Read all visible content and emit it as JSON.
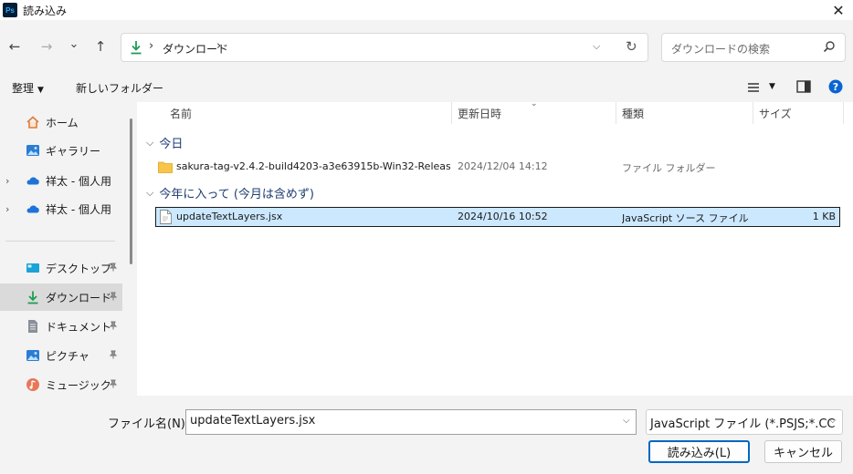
{
  "window": {
    "app_icon_text": "Ps",
    "title": "読み込み",
    "close_glyph": "✕"
  },
  "nav": {
    "back_glyph": "←",
    "forward_glyph": "→",
    "recent_glyph": "⌄",
    "up_glyph": "↑",
    "breadcrumb_sep": "›",
    "breadcrumb": [
      "ダウンロード"
    ],
    "dropdown_glyph": "⌵",
    "refresh_glyph": "↻",
    "search_placeholder": "ダウンロードの検索"
  },
  "command_bar": {
    "organize": "整理",
    "new_folder": "新しいフォルダー",
    "dropdown_glyph": "▼"
  },
  "sidebar": {
    "items": [
      {
        "label": "ホーム",
        "icon": "home-icon",
        "expandable": false,
        "pinned": false
      },
      {
        "label": "ギャラリー",
        "icon": "gallery-icon",
        "expandable": false,
        "pinned": false
      },
      {
        "label": "祥太 - 個人用",
        "icon": "cloud-icon",
        "expandable": true,
        "pinned": false
      },
      {
        "label": "祥太 - 個人用",
        "icon": "cloud-icon",
        "expandable": true,
        "pinned": false
      },
      {
        "label": "デスクトップ",
        "icon": "desktop-icon",
        "expandable": false,
        "pinned": true
      },
      {
        "label": "ダウンロード",
        "icon": "download-icon",
        "expandable": false,
        "pinned": true,
        "selected": true
      },
      {
        "label": "ドキュメント",
        "icon": "document-icon",
        "expandable": false,
        "pinned": true
      },
      {
        "label": "ピクチャ",
        "icon": "pictures-icon",
        "expandable": false,
        "pinned": true
      },
      {
        "label": "ミュージック",
        "icon": "music-icon",
        "expandable": false,
        "pinned": true
      }
    ],
    "expand_glyph": "›",
    "pin_glyph": "📌"
  },
  "file_list": {
    "columns": {
      "name": "名前",
      "date": "更新日時",
      "type": "種類",
      "size": "サイズ"
    },
    "sort_glyph": "⌄",
    "group_chevron": "⌵",
    "groups": [
      {
        "label": "今日",
        "rows": [
          {
            "name": "sakura-tag-v2.4.2-build4203-a3e63915b-Win32-Releas...",
            "date": "2024/12/04 14:12",
            "type": "ファイル フォルダー",
            "size": "",
            "kind": "folder"
          }
        ]
      },
      {
        "label": "今年に入って (今月は含めず)",
        "rows": [
          {
            "name": "updateTextLayers.jsx",
            "date": "2024/10/16 10:52",
            "type": "JavaScript ソース ファイル",
            "size": "1 KB",
            "kind": "file",
            "selected": true
          }
        ]
      }
    ]
  },
  "footer": {
    "filename_label": "ファイル名(N):",
    "filename_value": "updateTextLayers.jsx",
    "filetype_value": "JavaScript ファイル (*.PSJS;*.CC",
    "dropdown_glyph": "⌵",
    "open_button": "読み込み(L)",
    "cancel_button": "キャンセル"
  },
  "colors": {
    "accent": "#0067c0",
    "selection": "#cce8ff",
    "group_header": "#1f3e73",
    "folder": "#f8c54a",
    "download_green": "#1f9d55",
    "help": "#0a64d2"
  }
}
